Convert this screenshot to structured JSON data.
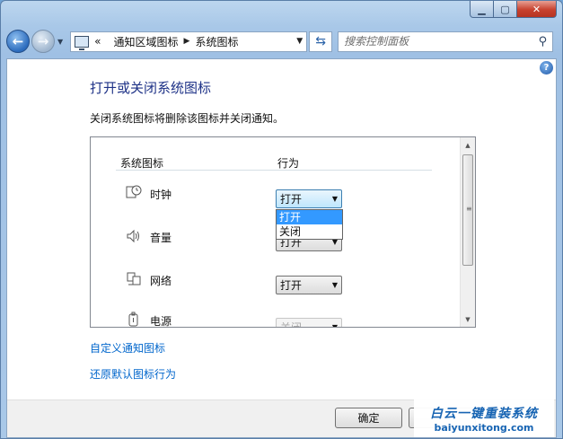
{
  "nav": {
    "breadcrumb_prefix": "«",
    "crumbs": [
      "通知区域图标",
      "系统图标"
    ],
    "search_placeholder": "搜索控制面板"
  },
  "page": {
    "title": "打开或关闭系统图标",
    "description": "关闭系统图标将删除该图标并关闭通知。"
  },
  "table": {
    "col_icon": "系统图标",
    "col_behavior": "行为",
    "rows": [
      {
        "label": "时钟",
        "value": "打开",
        "icon": "clock-icon"
      },
      {
        "label": "音量",
        "value": "打开",
        "icon": "speaker-icon"
      },
      {
        "label": "网络",
        "value": "打开",
        "icon": "network-icon"
      },
      {
        "label": "电源",
        "value": "关闭",
        "icon": "power-icon"
      }
    ]
  },
  "dropdown": {
    "options": [
      "打开",
      "关闭"
    ],
    "selected_index": 0
  },
  "links": {
    "customize": "自定义通知图标",
    "restore": "还原默认图标行为"
  },
  "footer": {
    "ok_label": "确定"
  },
  "watermark": {
    "line1": "白云一键重装系统",
    "line2": "baiyunxitong.com"
  }
}
